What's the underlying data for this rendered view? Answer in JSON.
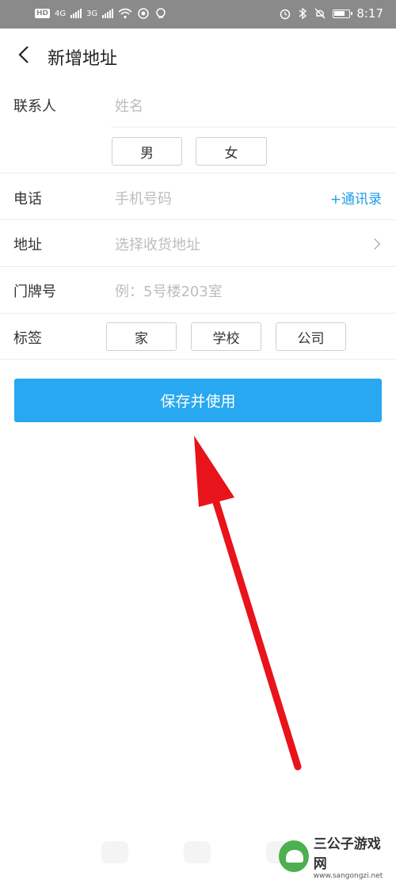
{
  "status_bar": {
    "network_hd": "HD",
    "network_4g": "4G",
    "network_3g": "3G",
    "time": "8:17"
  },
  "header": {
    "title": "新增地址"
  },
  "form": {
    "contact": {
      "label": "联系人",
      "placeholder": "姓名",
      "gender_options": [
        "男",
        "女"
      ]
    },
    "phone": {
      "label": "电话",
      "placeholder": "手机号码",
      "contacts_link": "+通讯录"
    },
    "address": {
      "label": "地址",
      "placeholder": "选择收货地址"
    },
    "door_number": {
      "label": "门牌号",
      "placeholder": "例：5号楼203室"
    },
    "tag": {
      "label": "标签",
      "options": [
        "家",
        "学校",
        "公司"
      ]
    }
  },
  "actions": {
    "save_label": "保存并使用"
  },
  "annotation": {
    "arrow_color": "#e8131b"
  },
  "watermark": {
    "name": "三公子游戏网",
    "url": "www.sangongzi.net"
  },
  "colors": {
    "primary": "#27a8f0",
    "link": "#1e9ee8"
  }
}
